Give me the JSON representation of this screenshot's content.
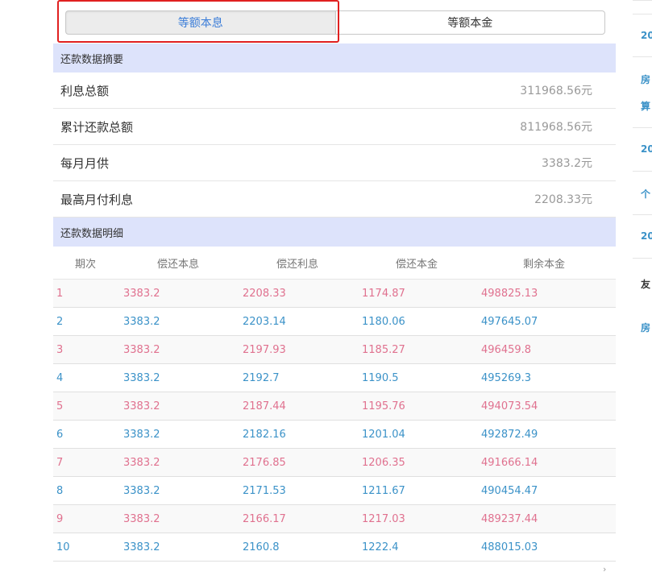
{
  "tabs": {
    "equal_payment": "等额本息",
    "equal_principal": "等额本金"
  },
  "summary": {
    "header": "还款数据摘要",
    "rows": [
      {
        "label": "利息总额",
        "value": "311968.56元"
      },
      {
        "label": "累计还款总额",
        "value": "811968.56元"
      },
      {
        "label": "每月月供",
        "value": "3383.2元"
      },
      {
        "label": "最高月付利息",
        "value": "2208.33元"
      }
    ]
  },
  "detail": {
    "header": "还款数据明细",
    "columns": [
      "期次",
      "偿还本息",
      "偿还利息",
      "偿还本金",
      "剩余本金"
    ],
    "rows": [
      [
        "1",
        "3383.2",
        "2208.33",
        "1174.87",
        "498825.13"
      ],
      [
        "2",
        "3383.2",
        "2203.14",
        "1180.06",
        "497645.07"
      ],
      [
        "3",
        "3383.2",
        "2197.93",
        "1185.27",
        "496459.8"
      ],
      [
        "4",
        "3383.2",
        "2192.7",
        "1190.5",
        "495269.3"
      ],
      [
        "5",
        "3383.2",
        "2187.44",
        "1195.76",
        "494073.54"
      ],
      [
        "6",
        "3383.2",
        "2182.16",
        "1201.04",
        "492872.49"
      ],
      [
        "7",
        "3383.2",
        "2176.85",
        "1206.35",
        "491666.14"
      ],
      [
        "8",
        "3383.2",
        "2171.53",
        "1211.67",
        "490454.47"
      ],
      [
        "9",
        "3383.2",
        "2166.17",
        "1217.03",
        "489237.44"
      ],
      [
        "10",
        "3383.2",
        "2160.8",
        "1222.4",
        "488015.03"
      ]
    ]
  },
  "sidebar": {
    "items": [
      "20",
      "房",
      "算",
      "20",
      "个",
      "20",
      "友",
      "房"
    ]
  },
  "colors": {
    "accent": "#3b7dd8",
    "odd_row_text": "#e0718f",
    "even_row_text": "#3b92c8",
    "section_bg": "#dde3fb",
    "highlight": "#e02020"
  },
  "icons": {
    "pager": "chevron-right-icon"
  }
}
